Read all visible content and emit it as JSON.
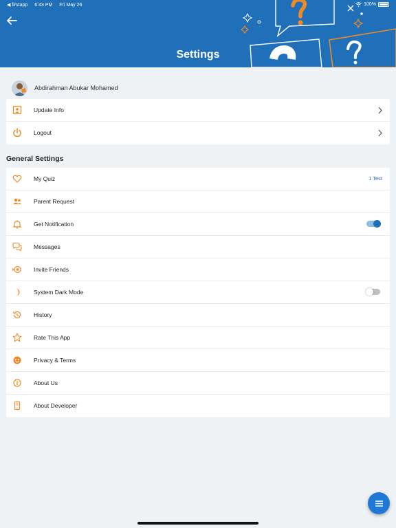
{
  "status_bar": {
    "carrier": "◀ firstapp",
    "time": "6:43 PM",
    "date": "Fri May 26",
    "battery": "100%"
  },
  "header": {
    "title": "Settings"
  },
  "profile": {
    "name": "Abdirahman Abukar Mohamed"
  },
  "account_items": [
    {
      "label": "Update Info",
      "icon": "id-card-icon"
    },
    {
      "label": "Logout",
      "icon": "power-icon"
    }
  ],
  "general": {
    "title": "General Settings",
    "items": [
      {
        "label": "My Quiz",
        "icon": "heart-icon",
        "value": "1 Test"
      },
      {
        "label": "Parent Request",
        "icon": "users-icon"
      },
      {
        "label": "Get Notification",
        "icon": "bell-icon",
        "toggle": "on"
      },
      {
        "label": "Messages",
        "icon": "chat-icon"
      },
      {
        "label": "Invite Friends",
        "icon": "invite-icon"
      },
      {
        "label": "System Dark Mode",
        "icon": "moon-icon",
        "toggle": "off"
      },
      {
        "label": "History",
        "icon": "history-icon"
      },
      {
        "label": "Rate This App",
        "icon": "star-icon"
      },
      {
        "label": "Privacy & Terms",
        "icon": "privacy-icon"
      },
      {
        "label": "About Us",
        "icon": "info-icon"
      },
      {
        "label": "About Developer",
        "icon": "phone-icon"
      }
    ]
  },
  "colors": {
    "primary": "#1f6fb9",
    "accent": "#f08a24",
    "background": "#eef2f5"
  }
}
